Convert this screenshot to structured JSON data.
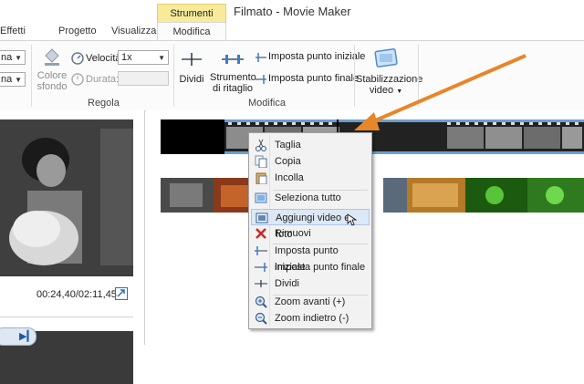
{
  "titlebar": {
    "context_group": "Strumenti video",
    "app_title": "Filmato - Movie Maker"
  },
  "tabs": [
    {
      "label": "Effetti visivi"
    },
    {
      "label": "Progetto"
    },
    {
      "label": "Visualizza"
    },
    {
      "label": "Modifica",
      "active": true
    }
  ],
  "ribbon": {
    "combo_left_1": "na",
    "combo_left_2": "na",
    "colore_sfondo_label": "Colore sfondo",
    "velocita_label": "Velocità:",
    "velocita_value": "1x",
    "durata_label": "Durata:",
    "regola_group": "Regola",
    "dividi_label": "Dividi",
    "strumento_ritaglio_label": "Strumento di ritaglio",
    "imposta_inizio": "Imposta punto iniziale",
    "imposta_fine": "Imposta punto finale",
    "modifica_group": "Modifica",
    "stabilizzazione_label": "Stabilizzazione video"
  },
  "preview": {
    "time": "00:24,40/02:11,45"
  },
  "context_menu": {
    "items": [
      {
        "label": "Taglia",
        "icon": "scissors-icon"
      },
      {
        "label": "Copia",
        "icon": "copy-icon"
      },
      {
        "label": "Incolla",
        "icon": "paste-icon"
      },
      {
        "label": "Seleziona tutto",
        "icon": "select-all-icon"
      },
      {
        "label": "Aggiungi video e foto",
        "icon": "add-media-icon",
        "highlighted": true
      },
      {
        "label": "Rimuovi",
        "icon": "remove-icon"
      },
      {
        "label": "Imposta punto iniziale",
        "icon": "set-start-icon"
      },
      {
        "label": "Imposta punto finale",
        "icon": "set-end-icon"
      },
      {
        "label": "Dividi",
        "icon": "split-icon"
      },
      {
        "label": "Zoom avanti (+)",
        "icon": "zoom-in-icon"
      },
      {
        "label": "Zoom indietro (-)",
        "icon": "zoom-out-icon"
      }
    ]
  },
  "colors": {
    "accent_arrow": "#e8862a",
    "selection_blue": "#5b9bd5",
    "context_tab": "#f7eb9a"
  }
}
